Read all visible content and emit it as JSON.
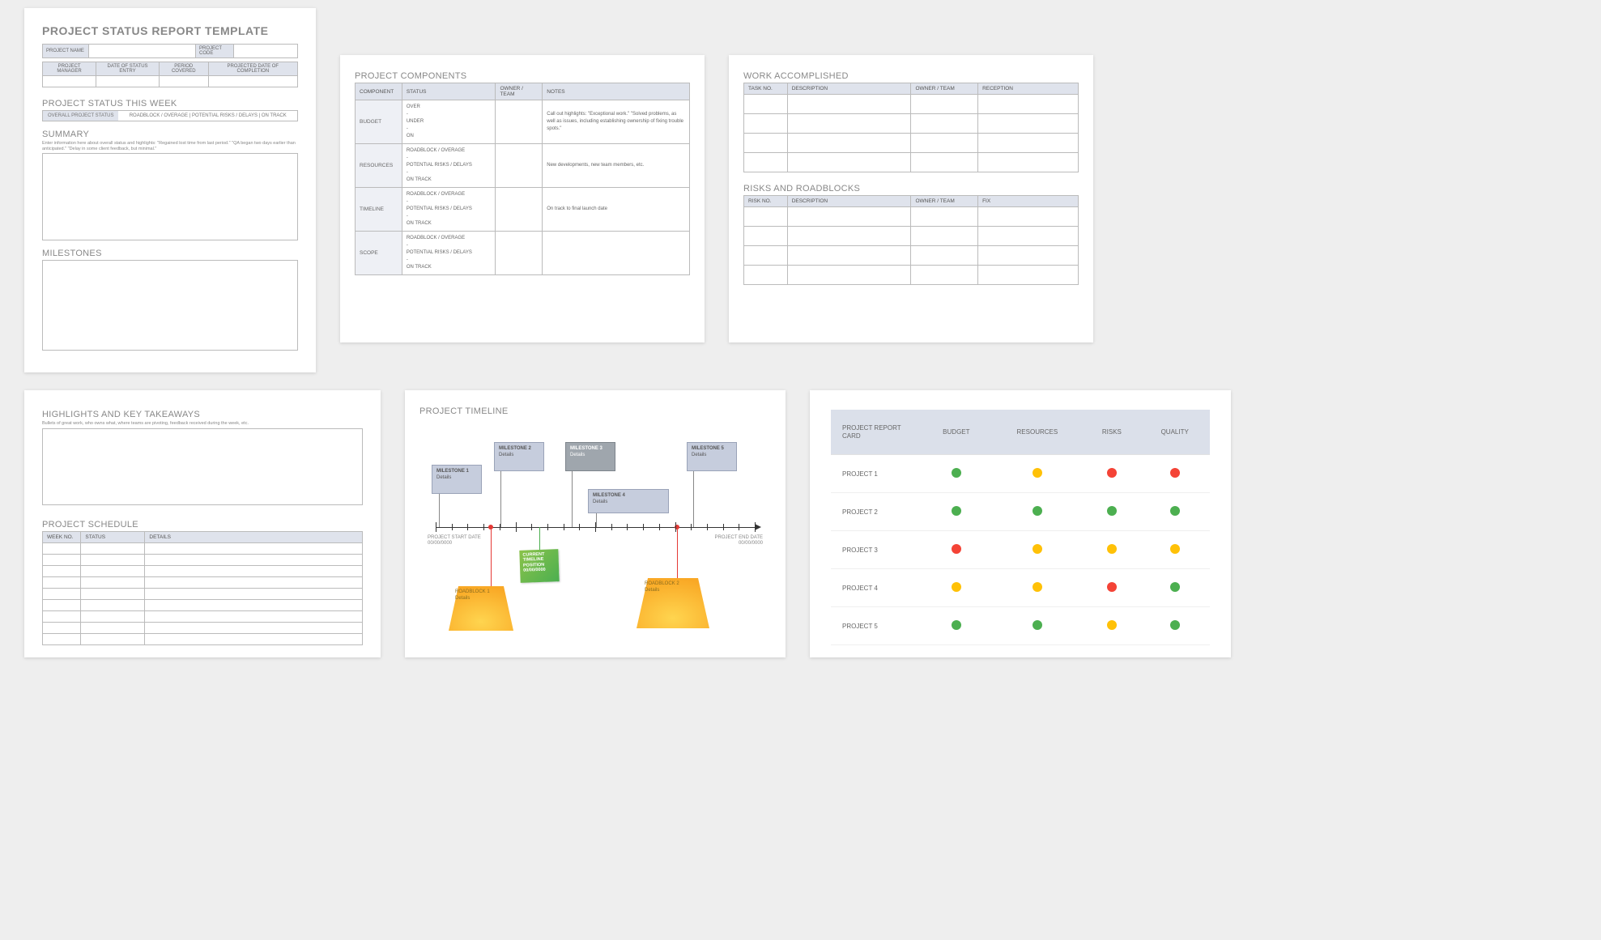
{
  "card1": {
    "title": "PROJECT STATUS REPORT TEMPLATE",
    "meta1": {
      "name_label": "PROJECT NAME",
      "code_label": "PROJECT CODE"
    },
    "meta2": {
      "pm": "PROJECT MANAGER",
      "date_entry": "DATE OF STATUS ENTRY",
      "period": "PERIOD COVERED",
      "projected": "PROJECTED DATE OF COMPLETION"
    },
    "status_week_title": "PROJECT STATUS THIS WEEK",
    "overall_label": "OVERALL PROJECT STATUS",
    "overall_opts": "ROADBLOCK / OVERAGE   |   POTENTIAL RISKS / DELAYS   |   ON TRACK",
    "summary_title": "SUMMARY",
    "summary_hint": "Enter information here about overall status and highlights: \"Regained lost time from last period.\" \"QA began two days earlier than anticipated.\" \"Delay in some client feedback, but minimal.\"",
    "milestones_title": "MILESTONES"
  },
  "card2": {
    "title": "PROJECT COMPONENTS",
    "headers": [
      "COMPONENT",
      "STATUS",
      "OWNER / TEAM",
      "NOTES"
    ],
    "rows": [
      {
        "comp": "BUDGET",
        "status": "OVER\n-\nUNDER\n-\nON",
        "notes": "Call out highlights: \"Exceptional work.\" \"Solved problems, as well as issues, including establishing ownership of fixing trouble spots.\""
      },
      {
        "comp": "RESOURCES",
        "status": "ROADBLOCK / OVERAGE\n-\nPOTENTIAL RISKS / DELAYS\n-\nON TRACK",
        "notes": "New developments, new team members, etc."
      },
      {
        "comp": "TIMELINE",
        "status": "ROADBLOCK / OVERAGE\n-\nPOTENTIAL RISKS / DELAYS\n-\nON TRACK",
        "notes": "On track to final launch date"
      },
      {
        "comp": "SCOPE",
        "status": "ROADBLOCK / OVERAGE\n-\nPOTENTIAL RISKS / DELAYS\n-\nON TRACK",
        "notes": ""
      }
    ]
  },
  "card3": {
    "work_title": "WORK ACCOMPLISHED",
    "work_headers": [
      "TASK NO.",
      "DESCRIPTION",
      "OWNER / TEAM",
      "RECEPTION"
    ],
    "risks_title": "RISKS AND ROADBLOCKS",
    "risks_headers": [
      "RISK NO.",
      "DESCRIPTION",
      "OWNER / TEAM",
      "FIX"
    ]
  },
  "card4": {
    "high_title": "HIGHLIGHTS AND KEY TAKEAWAYS",
    "high_hint": "Bullets of great work, who owns what, where teams are pivoting, feedback received during the week, etc.",
    "sched_title": "PROJECT SCHEDULE",
    "sched_headers": [
      "WEEK NO.",
      "STATUS",
      "DETAILS"
    ]
  },
  "card5": {
    "title": "PROJECT TIMELINE",
    "start_label": "PROJECT START DATE",
    "start_date": "00/00/0000",
    "end_label": "PROJECT END DATE",
    "end_date": "00/00/0000",
    "ms": [
      {
        "t": "MILESTONE 1",
        "d": "Details"
      },
      {
        "t": "MILESTONE 2",
        "d": "Details"
      },
      {
        "t": "MILESTONE 3",
        "d": "Details"
      },
      {
        "t": "MILESTONE 4",
        "d": "Details"
      },
      {
        "t": "MILESTONE 5",
        "d": "Details"
      }
    ],
    "current": {
      "l1": "CURRENT",
      "l2": "TIMELINE",
      "l3": "POSITION",
      "l4": "00/00/0000"
    },
    "rb": [
      {
        "t": "ROADBLOCK 1",
        "d": "Details"
      },
      {
        "t": "ROADBLOCK 2",
        "d": "Details"
      }
    ]
  },
  "card6": {
    "headers": [
      "PROJECT REPORT CARD",
      "BUDGET",
      "RESOURCES",
      "RISKS",
      "QUALITY"
    ],
    "rows": [
      {
        "name": "PROJECT 1",
        "vals": [
          "g",
          "y",
          "r",
          "r"
        ]
      },
      {
        "name": "PROJECT 2",
        "vals": [
          "g",
          "g",
          "g",
          "g"
        ]
      },
      {
        "name": "PROJECT 3",
        "vals": [
          "r",
          "y",
          "y",
          "y"
        ]
      },
      {
        "name": "PROJECT 4",
        "vals": [
          "y",
          "y",
          "r",
          "g"
        ]
      },
      {
        "name": "PROJECT 5",
        "vals": [
          "g",
          "g",
          "y",
          "g"
        ]
      }
    ]
  }
}
